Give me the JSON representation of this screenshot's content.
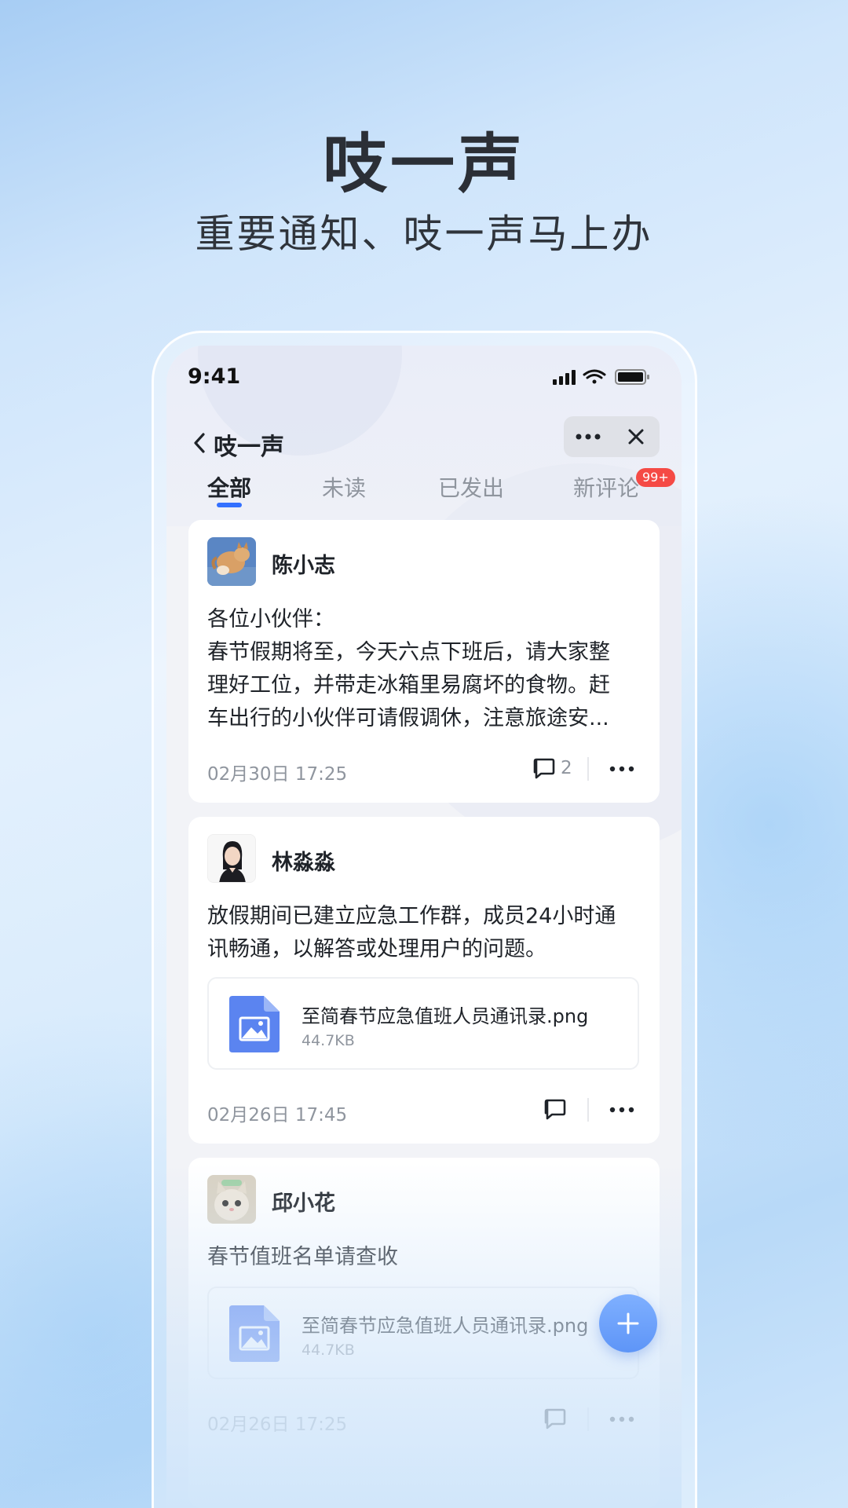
{
  "hero": {
    "title": "吱一声",
    "subtitle": "重要通知、吱一声马上办"
  },
  "status_bar": {
    "time": "9:41",
    "icons": [
      "cellular-signal-icon",
      "wifi-icon",
      "battery-icon"
    ]
  },
  "nav": {
    "back_icon": "chevron-left-icon",
    "title": "吱一声",
    "more_icon": "ellipsis-icon",
    "close_icon": "close-icon"
  },
  "tabs": [
    {
      "label": "全部",
      "active": true
    },
    {
      "label": "未读",
      "active": false
    },
    {
      "label": "已发出",
      "active": false
    },
    {
      "label": "新评论",
      "active": false,
      "badge": "99+"
    }
  ],
  "posts": [
    {
      "author": "陈小志",
      "avatar": "cat-avatar",
      "content_lines": [
        "各位小伙伴：",
        "春节假期将至，今天六点下班后，请大家整",
        "理好工位，并带走冰箱里易腐坏的食物。赶",
        "车出行的小伙伴可请假调休，注意旅途安..."
      ],
      "date": "02月30日 17:25",
      "comment_count": "2"
    },
    {
      "author": "林淼淼",
      "avatar": "person-avatar",
      "content_lines": [
        "放假期间已建立应急工作群，成员24小时通",
        "讯畅通，以解答或处理用户的问题。"
      ],
      "attachment": {
        "name": "至简春节应急值班人员通讯录.png",
        "size": "44.7KB",
        "icon": "image-file-icon"
      },
      "date": "02月26日 17:45",
      "comment_count": ""
    },
    {
      "author": "邱小花",
      "avatar": "kitten-avatar",
      "content_lines": [
        "春节值班名单请查收"
      ],
      "attachment": {
        "name": "至简春节应急值班人员通讯录.png",
        "size": "44.7KB",
        "icon": "image-file-icon"
      },
      "date": "02月26日 17:25",
      "comment_count": ""
    }
  ],
  "fab": {
    "icon": "plus-icon"
  },
  "colors": {
    "accent": "#3370ff",
    "badge": "#f54a45",
    "fab": "#6a9ff8"
  }
}
